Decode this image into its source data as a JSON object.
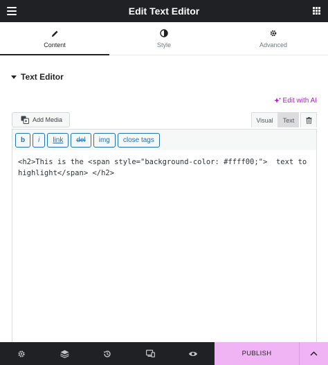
{
  "header": {
    "title": "Edit Text Editor",
    "menu_icon": "hamburger-icon",
    "apps_icon": "grid-icon"
  },
  "tabs": [
    {
      "label": "Content",
      "icon": "pencil-icon",
      "active": true
    },
    {
      "label": "Style",
      "icon": "half-circle-icon",
      "active": false
    },
    {
      "label": "Advanced",
      "icon": "gear-icon",
      "active": false
    }
  ],
  "section": {
    "title": "Text Editor"
  },
  "ai_link": {
    "label": "Edit with AI",
    "color": "#b018d1"
  },
  "editor": {
    "add_media_label": "Add Media",
    "modes": {
      "visual": "Visual",
      "text": "Text"
    },
    "quicktags": [
      "b",
      "i",
      "link",
      "del",
      "img",
      "close tags"
    ],
    "content": "<h2>This is the <span style=\"background-color: #ffff00;\">  text to highlight</span> </h2>"
  },
  "footer": {
    "publish_label": "PUBLISH",
    "publish_color": "#f0b4f4"
  }
}
